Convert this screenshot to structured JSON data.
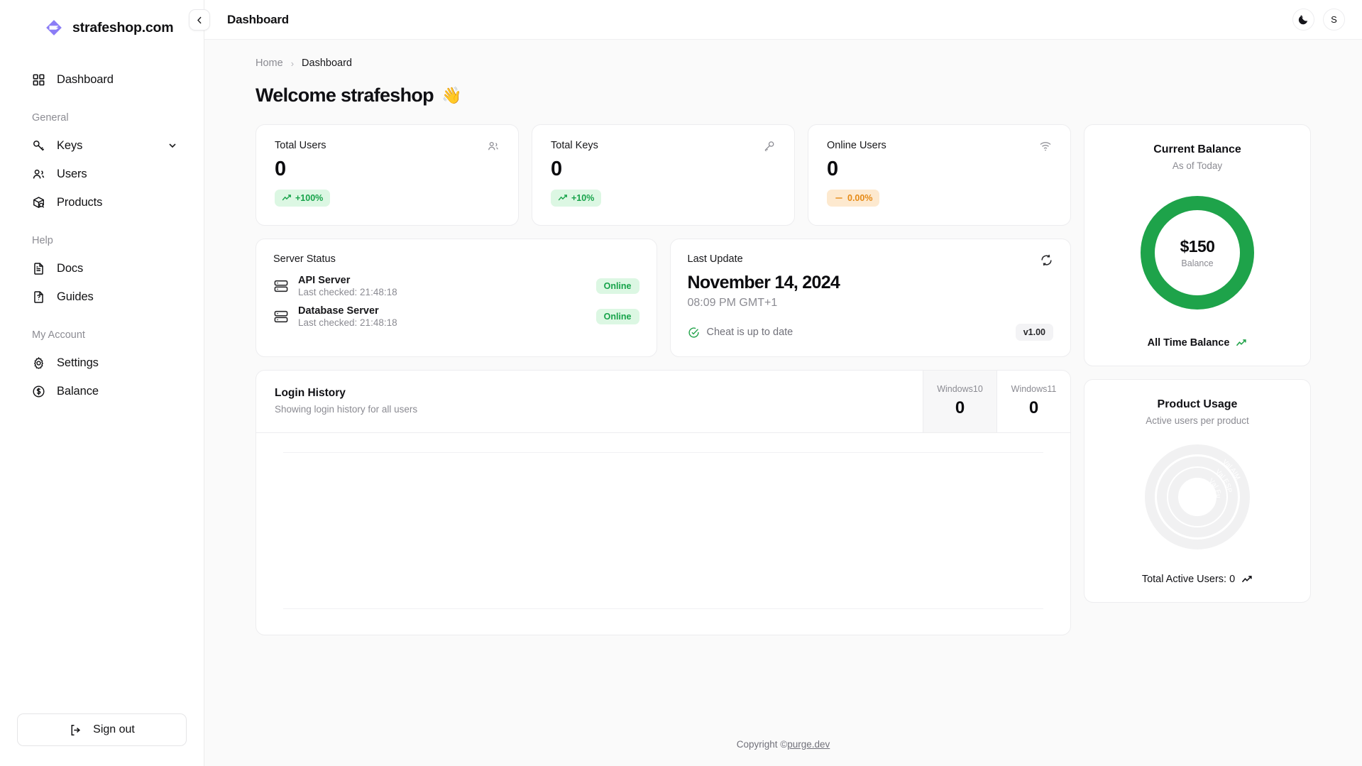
{
  "brand": {
    "name": "strafeshop.com",
    "logo_icon": "diamond-logo-icon"
  },
  "sidebar": {
    "primary": [
      {
        "label": "Dashboard",
        "icon": "grid-icon"
      }
    ],
    "sections": [
      {
        "label": "General",
        "items": [
          {
            "label": "Keys",
            "icon": "key-icon",
            "chevron": "chevron-down-icon"
          },
          {
            "label": "Users",
            "icon": "users-icon"
          },
          {
            "label": "Products",
            "icon": "package-search-icon"
          }
        ]
      },
      {
        "label": "Help",
        "items": [
          {
            "label": "Docs",
            "icon": "file-text-icon"
          },
          {
            "label": "Guides",
            "icon": "file-question-icon"
          }
        ]
      },
      {
        "label": "My Account",
        "items": [
          {
            "label": "Settings",
            "icon": "gear-icon"
          },
          {
            "label": "Balance",
            "icon": "dollar-circle-icon"
          }
        ]
      }
    ],
    "sign_out": {
      "label": "Sign out",
      "icon": "logout-icon"
    }
  },
  "topbar": {
    "title": "Dashboard",
    "collapse_icon": "chevron-left-icon",
    "theme_toggle_icon": "moon-stars-icon",
    "avatar_initial": "S"
  },
  "breadcrumb": {
    "home": "Home",
    "separator": "›",
    "current": "Dashboard"
  },
  "page_title": {
    "text": "Welcome strafeshop",
    "emoji": "👋"
  },
  "stats": [
    {
      "title": "Total Users",
      "value": "0",
      "icon": "users-icon",
      "badge": "+100%",
      "badge_tone": "green",
      "trend_icon": "trend-up-icon"
    },
    {
      "title": "Total Keys",
      "value": "0",
      "icon": "key-icon",
      "badge": "+10%",
      "badge_tone": "green",
      "trend_icon": "trend-up-icon"
    },
    {
      "title": "Online Users",
      "value": "0",
      "icon": "wifi-icon",
      "badge": "0.00%",
      "badge_tone": "amber",
      "trend_icon": "minus-icon"
    }
  ],
  "server_status": {
    "title": "Server Status",
    "rows": [
      {
        "name": "API Server",
        "sub": "Last checked: 21:48:18",
        "status": "Online",
        "icon": "server-icon"
      },
      {
        "name": "Database Server",
        "sub": "Last checked: 21:48:18",
        "status": "Online",
        "icon": "server-icon"
      }
    ]
  },
  "last_update": {
    "label": "Last Update",
    "refresh_icon": "refresh-icon",
    "date": "November 14, 2024",
    "time": "08:09 PM GMT+1",
    "status": "Cheat is up to date",
    "status_icon": "check-circle-icon",
    "version": "v1.00"
  },
  "login_history": {
    "title": "Login History",
    "subtitle": "Showing login history for all users",
    "stats": [
      {
        "label": "Windows10",
        "value": "0",
        "active": true
      },
      {
        "label": "Windows11",
        "value": "0",
        "active": false
      }
    ]
  },
  "balance": {
    "title": "Current Balance",
    "subtitle": "As of Today",
    "value": "$150",
    "label": "Balance",
    "footer": "All Time Balance",
    "footer_icon": "trend-up-icon",
    "ring_color": "#1ea34a",
    "ring_percent": 100
  },
  "product_usage": {
    "title": "Product Usage",
    "subtitle": "Active users per product",
    "rings": [
      {
        "label": "Val AIM",
        "value": 0
      },
      {
        "label": "Val ESP",
        "value": 0
      },
      {
        "label": "Val Full",
        "value": 0
      }
    ],
    "footer": "Total Active Users: 0",
    "footer_icon": "trend-up-icon"
  },
  "footer": {
    "prefix": "Copyright © ",
    "link": "purge.dev"
  },
  "chart_data": [
    {
      "type": "line",
      "title": "Login History",
      "subtitle": "Showing login history for all users",
      "series": [
        {
          "name": "Windows10",
          "values": []
        },
        {
          "name": "Windows11",
          "values": []
        }
      ],
      "categories": [],
      "xlabel": "",
      "ylabel": "",
      "grid": true,
      "legend": "top-right",
      "note": "empty chart - no data points plotted"
    },
    {
      "type": "pie",
      "title": "Current Balance",
      "subtitle": "As of Today",
      "categories": [
        "Balance"
      ],
      "values": [
        150
      ],
      "center_label": "$150",
      "colors": [
        "#1ea34a"
      ]
    },
    {
      "type": "pie",
      "title": "Product Usage",
      "subtitle": "Active users per product",
      "categories": [
        "Val AIM",
        "Val ESP",
        "Val Full"
      ],
      "values": [
        0,
        0,
        0
      ],
      "total": 0,
      "colors": [
        "#f1f1f2",
        "#f1f1f2",
        "#f1f1f2"
      ],
      "note": "concentric empty rings, no active users"
    }
  ]
}
